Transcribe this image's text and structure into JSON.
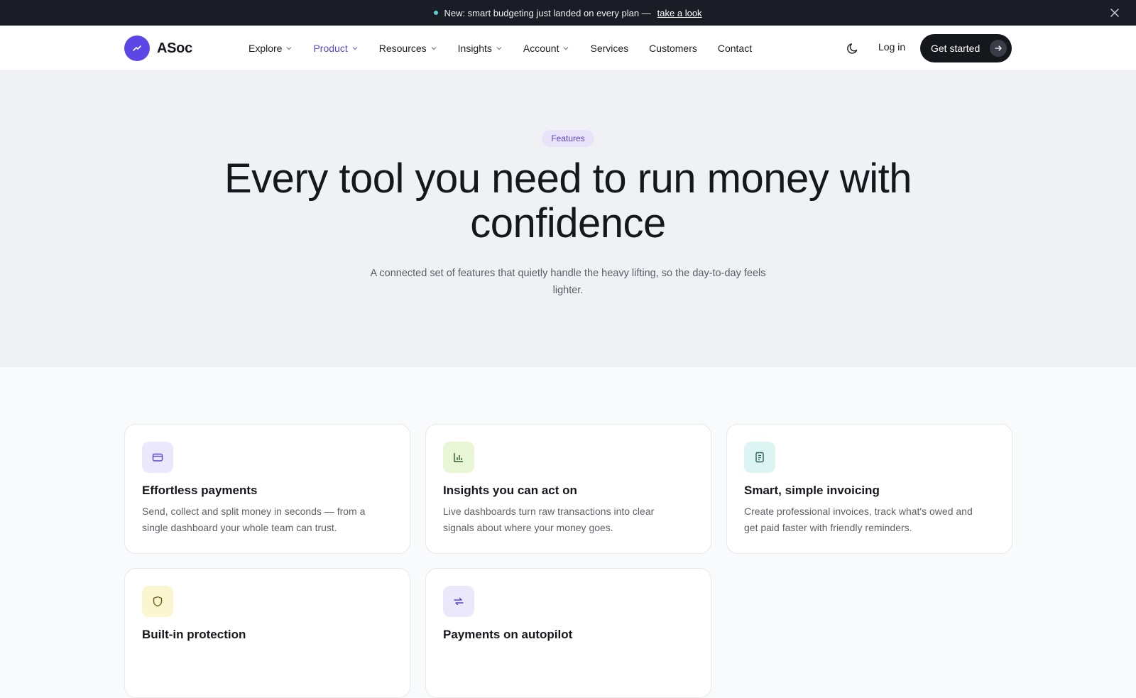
{
  "announcement": {
    "text": "New: smart budgeting just landed on every plan —",
    "link": "take a look",
    "close_icon": "close-icon"
  },
  "nav": {
    "brand": "ASoc",
    "items": [
      {
        "label": "Explore",
        "dropdown": true
      },
      {
        "label": "Product",
        "dropdown": true,
        "active": true
      },
      {
        "label": "Resources",
        "dropdown": true
      },
      {
        "label": "Insights",
        "dropdown": true
      },
      {
        "label": "Account",
        "dropdown": true
      },
      {
        "label": "Services",
        "dropdown": false
      },
      {
        "label": "Customers",
        "dropdown": false
      },
      {
        "label": "Contact",
        "dropdown": false
      }
    ],
    "login": "Log in",
    "cta": "Get started"
  },
  "hero": {
    "badge": "Features",
    "title": "Every tool you need to run money with confidence",
    "subtitle": "A connected set of features that quietly handle the heavy lifting, so the day-to-day feels lighter."
  },
  "features": [
    {
      "title": "Effortless payments",
      "text": "Send, collect and split money in seconds — from a single dashboard your whole team can trust.",
      "icon": "wallet-icon",
      "color": "#ece8fb"
    },
    {
      "title": "Insights you can act on",
      "text": "Live dashboards turn raw transactions into clear signals about where your money goes.",
      "icon": "bar-chart-icon",
      "color": "#e8f6d6"
    },
    {
      "title": "Smart, simple invoicing",
      "text": "Create professional invoices, track what's owed and get paid faster with friendly reminders.",
      "icon": "receipt-icon",
      "color": "#dcf4f2"
    },
    {
      "title": "Built-in protection",
      "text": "",
      "icon": "shield-icon",
      "color": "#fbf6cf"
    },
    {
      "title": "Payments on autopilot",
      "text": "",
      "icon": "repeat-icon",
      "color": "#ece8fb"
    }
  ],
  "colors": {
    "accent": "#5b46e6",
    "dark": "#16171d",
    "hero_bg": "#f0f1f5"
  }
}
